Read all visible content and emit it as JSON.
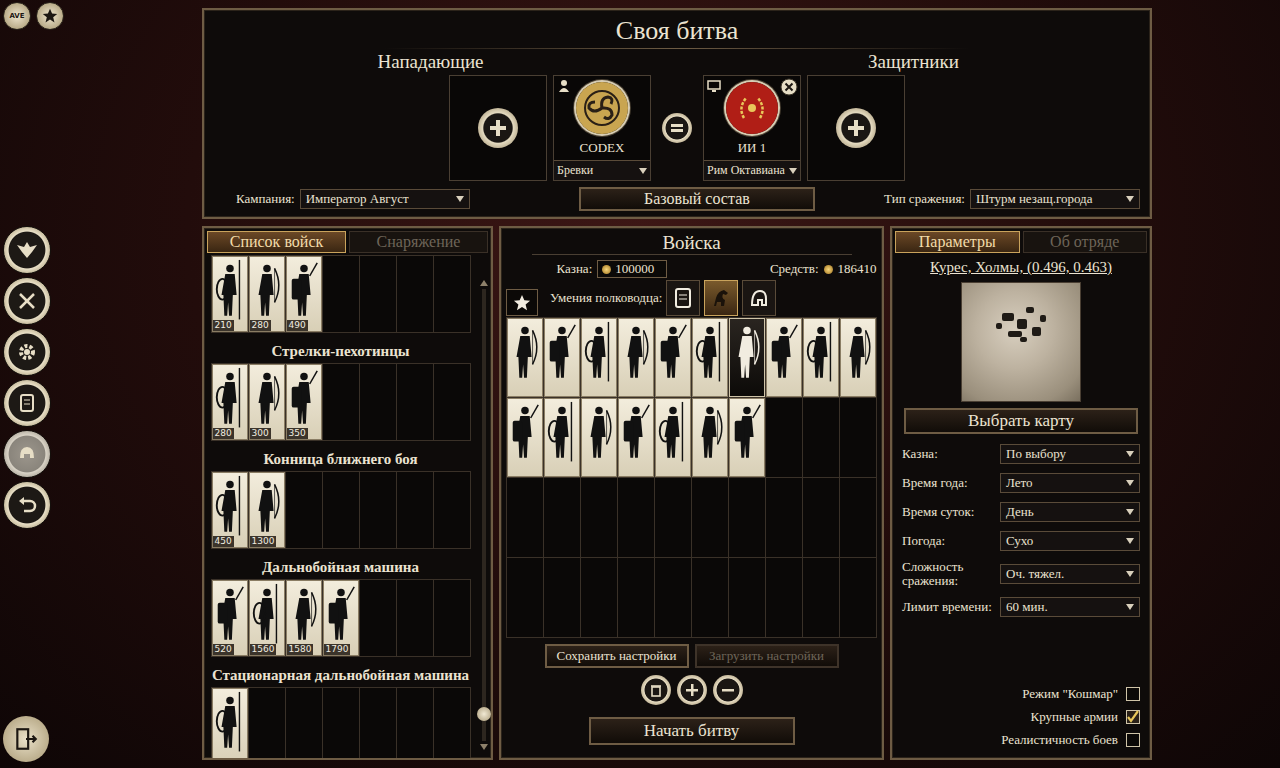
{
  "top_left": {
    "ave": "AVE"
  },
  "rail": {
    "items": [
      {
        "disabled": false
      },
      {
        "disabled": false
      },
      {
        "disabled": false
      },
      {
        "disabled": false
      },
      {
        "disabled": true
      },
      {
        "disabled": false
      }
    ]
  },
  "title": "Своя битва",
  "attackers": {
    "label": "Нападающие",
    "slots": [
      {
        "name": "CODEX",
        "faction": "Бревки",
        "kind": "human",
        "removable": false,
        "color": "#c9a550"
      }
    ]
  },
  "defenders": {
    "label": "Защитники",
    "slots": [
      {
        "name": "ИИ 1",
        "faction": "Рим Октавиана",
        "kind": "ai",
        "removable": true,
        "color": "#b01e16"
      }
    ]
  },
  "campaign": {
    "label": "Кампания:",
    "value": "Император Август"
  },
  "base_button": "Базовый состав",
  "battle_type": {
    "label": "Тип сражения:",
    "value": "Штурм незащ.города"
  },
  "left_tabs": [
    {
      "label": "Список войск",
      "selected": true
    },
    {
      "label": "Снаряжение",
      "selected": false
    }
  ],
  "unit_list": {
    "groups": [
      {
        "units": [
          {
            "cost": "210"
          },
          {
            "cost": "280"
          },
          {
            "cost": "490"
          }
        ]
      },
      {
        "title": "Стрелки-пехотинцы",
        "units": [
          {
            "cost": "280"
          },
          {
            "cost": "300"
          },
          {
            "cost": "350"
          }
        ]
      },
      {
        "title": "Конница ближнего боя",
        "units": [
          {
            "cost": "450"
          },
          {
            "cost": "1300"
          }
        ]
      },
      {
        "title": "Дальнобойная машина",
        "units": [
          {
            "cost": "520"
          },
          {
            "cost": "1560"
          },
          {
            "cost": "1580"
          },
          {
            "cost": "1790"
          }
        ]
      },
      {
        "title": "Стационарная дальнобойная машина",
        "units": [
          {}
        ]
      }
    ],
    "scrollbar": {
      "level": 0.94
    }
  },
  "army": {
    "title": "Войска",
    "treasury_label": "Казна:",
    "treasury": "100000",
    "funds_label": "Средств:",
    "funds": "186410",
    "skills_label": "Умения полководца:",
    "skills": [
      {
        "selected": false
      },
      {
        "selected": true
      },
      {
        "selected": false
      }
    ],
    "units": [
      {
        "selected": false
      },
      {
        "selected": false
      },
      {
        "selected": false
      },
      {
        "selected": false
      },
      {
        "selected": false
      },
      {
        "selected": false
      },
      {
        "selected": true
      },
      {
        "selected": false
      },
      {
        "selected": false
      },
      {
        "selected": false
      },
      {
        "selected": false
      },
      {
        "selected": false
      },
      {
        "selected": false
      },
      {
        "selected": false
      },
      {
        "selected": false
      },
      {
        "selected": false
      },
      {
        "selected": false
      }
    ]
  },
  "save_button": "Сохранить настройки",
  "load_button": {
    "label": "Загрузить настройки",
    "disabled": true
  },
  "start_button": "Начать битву",
  "right_tabs": [
    {
      "label": "Параметры",
      "selected": true
    },
    {
      "label": "Об отряде",
      "selected": false
    }
  ],
  "map": {
    "name": "Курес, Холмы, (0.496, 0.463)",
    "button": "Выбрать карту"
  },
  "settings": [
    {
      "label": "Казна:",
      "value": "По выбору"
    },
    {
      "label": "Время года:",
      "value": "Лето"
    },
    {
      "label": "Время суток:",
      "value": "День"
    },
    {
      "label": "Погода:",
      "value": "Сухо"
    },
    {
      "label": "Сложность сражения:",
      "value": "Оч. тяжел."
    },
    {
      "label": "Лимит времени:",
      "value": "60 мин."
    }
  ],
  "options": [
    {
      "label": "Режим \"Кошмар\"",
      "checked": false
    },
    {
      "label": "Крупные армии",
      "checked": true
    },
    {
      "label": "Реалистичность боев",
      "checked": false
    }
  ]
}
